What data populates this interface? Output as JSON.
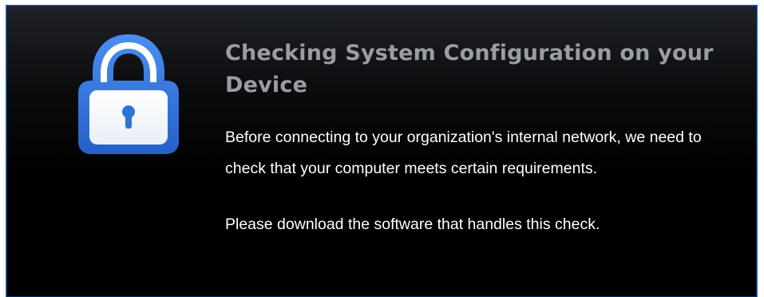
{
  "dialog": {
    "icon": "padlock-icon",
    "title": "Checking System Configuration on your Device",
    "paragraph_1": "Before connecting to your organization's internal network, we need to check that your computer meets certain requirements.",
    "paragraph_2": "Please download the software that handles this check."
  },
  "colors": {
    "border_accent": "#1e6fd6",
    "background": "#000000",
    "title_text": "#9a9da2",
    "body_text": "#ffffff",
    "icon_blue": "#2f73d8",
    "icon_inner": "#ffffff"
  }
}
